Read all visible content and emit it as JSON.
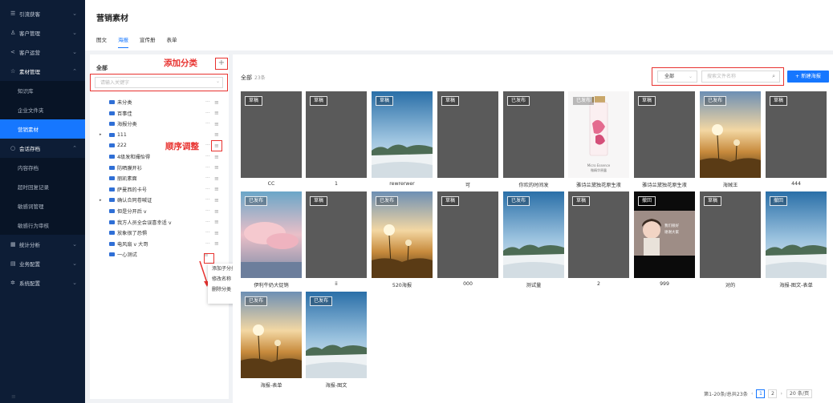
{
  "sidebar": {
    "items": [
      {
        "icon": "list-icon",
        "label": "引流获客",
        "expanded": false
      },
      {
        "icon": "users-icon",
        "label": "客户管理",
        "expanded": false
      },
      {
        "icon": "share-icon",
        "label": "客户运营",
        "expanded": false
      },
      {
        "icon": "star-icon",
        "label": "素材管理",
        "expanded": true
      }
    ],
    "material_sub": [
      "知识库",
      "企业文件夹",
      "营销素材"
    ],
    "active_sub": "营销素材",
    "archive": {
      "icon": "circle-icon",
      "label": "会话存档"
    },
    "archive_sub": [
      "内容存档",
      "超时回复记录",
      "敏感词管理",
      "敏感行为审核"
    ],
    "bottom_items": [
      {
        "icon": "chart-icon",
        "label": "统计分析"
      },
      {
        "icon": "grid-icon",
        "label": "业务配置"
      },
      {
        "icon": "gear-icon",
        "label": "系统配置"
      }
    ]
  },
  "header": {
    "title": "营销素材",
    "tabs": [
      "图文",
      "海报",
      "宣传册",
      "表单"
    ],
    "active_tab": "海报"
  },
  "tree": {
    "root_label": "全部",
    "add_hint": "添加分类",
    "sort_hint": "顺序调整",
    "search_placeholder": "请输入关键字",
    "nodes": [
      {
        "label": "未分类",
        "has_children": false
      },
      {
        "label": "百事佳",
        "has_children": false
      },
      {
        "label": "海报分类",
        "has_children": false
      },
      {
        "label": "111",
        "has_children": true
      },
      {
        "label": "222",
        "has_children": false
      },
      {
        "label": "4级发和撮怡得",
        "has_children": false
      },
      {
        "label": "防晒膜开衫",
        "has_children": false
      },
      {
        "label": "丽凯素面",
        "has_children": false
      },
      {
        "label": "萨曼西的卡号",
        "has_children": false
      },
      {
        "label": "确认合同卷喊证",
        "has_children": true
      },
      {
        "label": "但是分开后 v",
        "has_children": false
      },
      {
        "label": "我方人员全会误喜幸适 v",
        "has_children": false
      },
      {
        "label": "放象很了恐惧",
        "has_children": false
      },
      {
        "label": "电风扇 v 大哥",
        "has_children": false
      },
      {
        "label": "一心测试",
        "has_children": false
      }
    ],
    "context_menu": [
      "添加子分类",
      "修改名称",
      "删除分类"
    ]
  },
  "main": {
    "all_label": "全部",
    "count_label": "23条",
    "filter_select": "全部",
    "search_placeholder": "搜索文件名称",
    "new_button": "+ 新建海报",
    "cards": [
      {
        "status": "草稿",
        "title": "CC",
        "image": "gray"
      },
      {
        "status": "草稿",
        "title": "1",
        "image": "gray"
      },
      {
        "status": "草稿",
        "title": "rewrerwer",
        "image": "sea-sky"
      },
      {
        "status": "草稿",
        "title": "可",
        "image": "gray"
      },
      {
        "status": "已发布",
        "title": "你欢的时间发",
        "image": "gray"
      },
      {
        "status": "已发布",
        "title": "雅诗兰黛独花原生液",
        "image": "bottle"
      },
      {
        "status": "草稿",
        "title": "雅诗兰黛独花原生液",
        "image": "gray"
      },
      {
        "status": "已发布",
        "title": "海贼王",
        "image": "flower-sunset"
      },
      {
        "status": "草稿",
        "title": "444",
        "image": "gray"
      },
      {
        "status": "已发布",
        "title": "伊利牛奶大促销",
        "image": "pink-sky"
      },
      {
        "status": "草稿",
        "title": "ii",
        "image": "gray"
      },
      {
        "status": "已发布",
        "title": "520海报",
        "image": "flower-sunset"
      },
      {
        "status": "草稿",
        "title": "000",
        "image": "gray"
      },
      {
        "status": "已发布",
        "title": "测试量",
        "image": "sea-sky"
      },
      {
        "status": "草稿",
        "title": "2",
        "image": "gray"
      },
      {
        "status": "撤回",
        "title": "999",
        "image": "child"
      },
      {
        "status": "草稿",
        "title": "对的",
        "image": "gray"
      },
      {
        "status": "撤回",
        "title": "海报-图文-表单",
        "image": "sea-sky"
      },
      {
        "status": "已发布",
        "title": "海报-表单",
        "image": "flower-sunset"
      },
      {
        "status": "已发布",
        "title": "海报-图文",
        "image": "sea-sky"
      }
    ]
  },
  "pager": {
    "summary": "第1-20条/总共23条",
    "pages": [
      "1",
      "2"
    ],
    "current": "1",
    "size": "20 条/页"
  },
  "bottle_text": [
    "Micro Essence",
    "微精华原露"
  ],
  "child_text": [
    "我们很好",
    "谢谢大家"
  ]
}
